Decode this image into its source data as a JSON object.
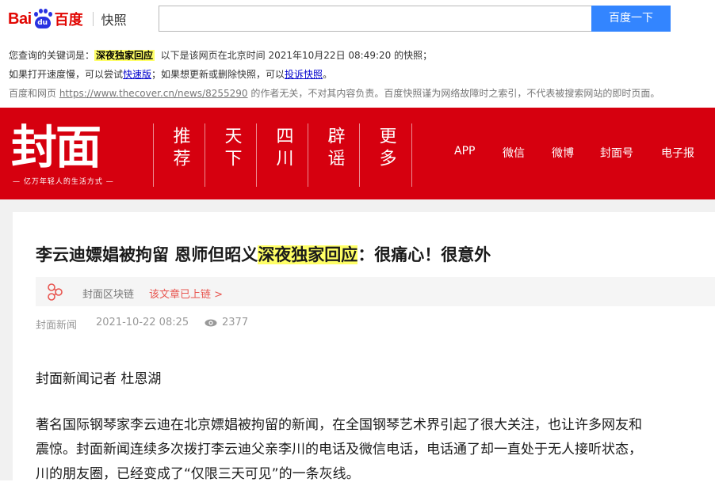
{
  "baidu": {
    "logo_bai": "Bai",
    "logo_du": "du",
    "logo_cn": "百度",
    "snapshot_label": "快照",
    "search_value": "",
    "search_button": "百度一下",
    "line1_prefix": "您查询的关键词是：",
    "keyword": "深夜独家回应",
    "line1_suffix": "以下是该网页在北京时间 2021年10月22日 08:49:20 的快照；",
    "line2_a": "如果打开速度慢，可以尝试",
    "fast_link": "快速版",
    "line2_b": "；如果想更新或删除快照，可以",
    "complain_link": "投诉快照",
    "line2_c": "。",
    "line3_a": "百度和网页 ",
    "source_url": "https://www.thecover.cn/news/8255290",
    "line3_b": " 的作者无关，不对其内容负责。百度快照谨为网络故障时之索引，不代表被搜索网站的即时页面。"
  },
  "site": {
    "logo": "封面",
    "slogan": "— 亿万年轻人的生活方式 —",
    "nav_vertical": [
      "推荐",
      "天下",
      "四川",
      "辟谣",
      "更多"
    ],
    "nav_right": [
      "APP",
      "微信",
      "微博",
      "封面号",
      "电子报"
    ]
  },
  "article": {
    "title_a": "李云迪嫖娼被拘留 恩师但昭义",
    "title_hl": "深夜独家回应",
    "title_b": "：很痛心！很意外",
    "chain_label": "封面区块链",
    "chain_link": "该文章已上链 >",
    "source": "封面新闻",
    "datetime": "2021-10-22 08:25",
    "views": "2377",
    "byline": "封面新闻记者 杜恩湖",
    "p1_l1": "著名国际钢琴家李云迪在北京嫖娼被拘留的新闻，在全国钢琴艺术界引起了很大关注，也让许多网友和",
    "p1_l2": "震惊。封面新闻连续多次拨打李云迪父亲李川的电话及微信电话，电话通了却一直处于无人接听状态，",
    "p1_l3": "川的朋友圈，已经变成了“仅限三天可见”的一条灰线。"
  },
  "colors": {
    "baidu_red": "#e10602",
    "baidu_blue": "#3385ff",
    "cover_red": "#d6000f",
    "highlight": "#ffff66"
  }
}
